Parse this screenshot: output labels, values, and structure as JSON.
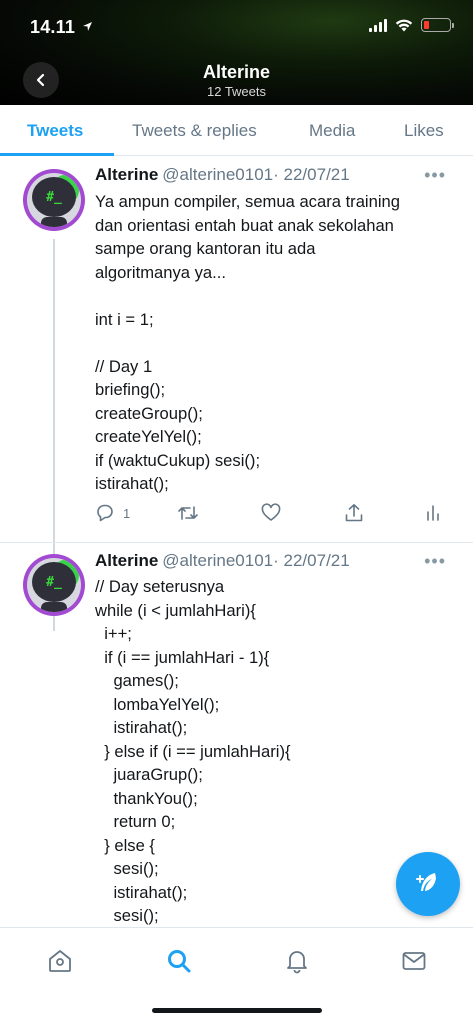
{
  "status_bar": {
    "time": "14.11",
    "battery_color": "#ff3b30"
  },
  "header": {
    "title": "Alterine",
    "subtitle": "12 Tweets"
  },
  "tabs": [
    {
      "label": "Tweets",
      "active": true
    },
    {
      "label": "Tweets & replies",
      "active": false
    },
    {
      "label": "Media",
      "active": false
    },
    {
      "label": "Likes",
      "active": false
    }
  ],
  "tweets": [
    {
      "name": "Alterine",
      "handle": "@alterine0101",
      "date": "· 22/07/21",
      "text": "Ya ampun compiler, semua acara training\ndan orientasi entah buat anak sekolahan\nsampe orang kantoran itu ada\nalgoritmanya ya...\n\nint i = 1;\n\n// Day 1\nbriefing();\ncreateGroup();\ncreateYelYel();\nif (waktuCukup) sesi();\nistirahat();",
      "reply_count": "1"
    },
    {
      "name": "Alterine",
      "handle": "@alterine0101",
      "date": "· 22/07/21",
      "text": "// Day seterusnya\nwhile (i < jumlahHari){\n  i++;\n  if (i == jumlahHari - 1){\n    games();\n    lombaYelYel();\n    istirahat();\n  } else if (i == jumlahHari){\n    juaraGrup();\n    thankYou();\n    return 0;\n  } else {\n    sesi();\n    istirahat();\n    sesi();"
    }
  ],
  "avatar_text": "#_",
  "colors": {
    "accent": "#1da1f2",
    "muted": "#657786",
    "avatar_ring": "#a24ad1"
  },
  "icons": [
    "back-arrow-icon",
    "signal-icon",
    "wifi-icon",
    "battery-icon",
    "more-icon",
    "reply-icon",
    "retweet-icon",
    "like-icon",
    "share-icon",
    "analytics-icon",
    "compose-icon",
    "home-icon",
    "search-icon",
    "notifications-icon",
    "messages-icon"
  ]
}
